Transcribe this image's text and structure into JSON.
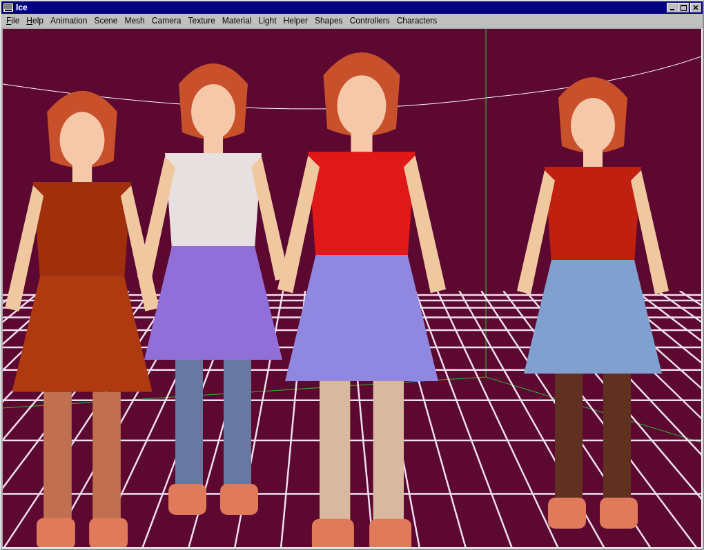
{
  "window": {
    "title": "Ice"
  },
  "menu": [
    {
      "label": "File",
      "mnemonic": true
    },
    {
      "label": "Help",
      "mnemonic": true
    },
    {
      "label": "Animation",
      "mnemonic": false
    },
    {
      "label": "Scene",
      "mnemonic": false
    },
    {
      "label": "Mesh",
      "mnemonic": false
    },
    {
      "label": "Camera",
      "mnemonic": false
    },
    {
      "label": "Texture",
      "mnemonic": false
    },
    {
      "label": "Material",
      "mnemonic": false
    },
    {
      "label": "Light",
      "mnemonic": false
    },
    {
      "label": "Helper",
      "mnemonic": false
    },
    {
      "label": "Shapes",
      "mnemonic": false
    },
    {
      "label": "Controllers",
      "mnemonic": false
    },
    {
      "label": "Characters",
      "mnemonic": false
    }
  ]
}
